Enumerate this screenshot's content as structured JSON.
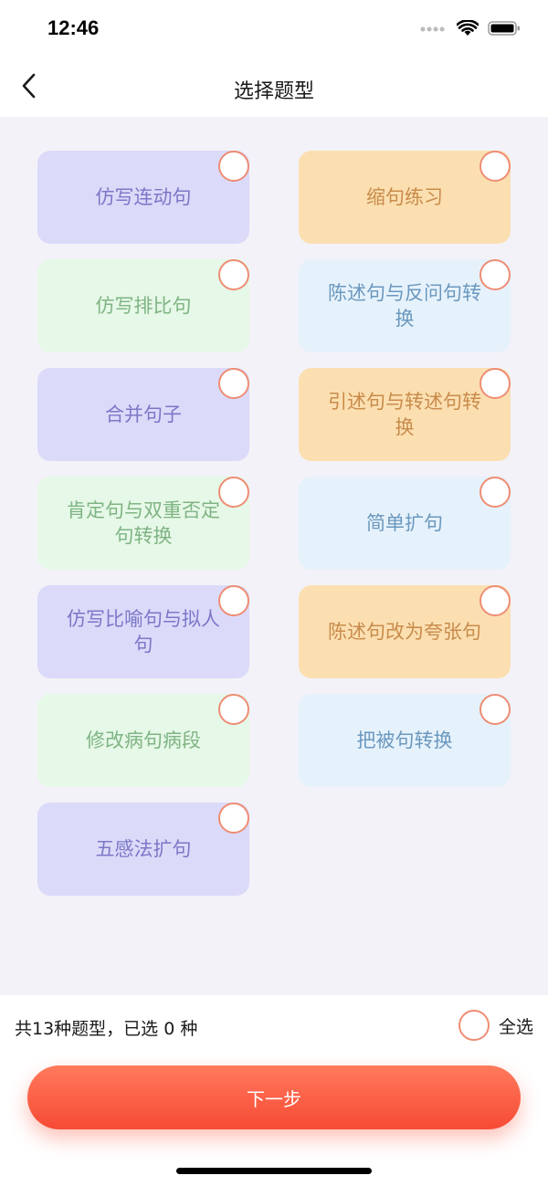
{
  "status": {
    "time": "12:46"
  },
  "nav": {
    "title": "选择题型"
  },
  "cards": [
    {
      "label": "仿写连动句",
      "color": "purple"
    },
    {
      "label": "缩句练习",
      "color": "orange"
    },
    {
      "label": "仿写排比句",
      "color": "green"
    },
    {
      "label": "陈述句与反问句转换",
      "color": "blue"
    },
    {
      "label": "合并句子",
      "color": "purple"
    },
    {
      "label": "引述句与转述句转换",
      "color": "orange"
    },
    {
      "label": "肯定句与双重否定句转换",
      "color": "green"
    },
    {
      "label": "简单扩句",
      "color": "blue"
    },
    {
      "label": "仿写比喻句与拟人句",
      "color": "purple"
    },
    {
      "label": "陈述句改为夸张句",
      "color": "orange"
    },
    {
      "label": "修改病句病段",
      "color": "green"
    },
    {
      "label": "把被句转换",
      "color": "blue"
    },
    {
      "label": "五感法扩句",
      "color": "purple"
    }
  ],
  "footer": {
    "count_text": "共13种题型，已选 0 种",
    "select_all_label": "全选",
    "next_label": "下一步"
  },
  "colors": {
    "accent": "#f74a35",
    "check_ring": "#ee8d74",
    "background": "#f3f2f8"
  }
}
